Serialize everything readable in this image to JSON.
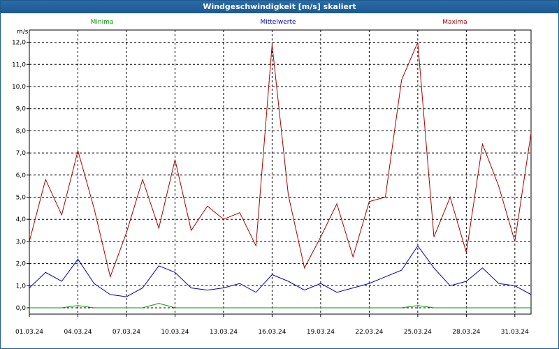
{
  "window": {
    "title": "Windgeschwindigkeit [m/s] skaliert"
  },
  "colors": {
    "minima": "#009900",
    "mean": "#0000bb",
    "maxima": "#aa0000"
  },
  "chart_data": {
    "type": "line",
    "title": "Windgeschwindigkeit [m/s] skaliert",
    "ylabel": "m/s",
    "ylim": [
      0,
      12.5
    ],
    "yticks": [
      "0,0",
      "1,0",
      "2,0",
      "3,0",
      "4,0",
      "5,0",
      "6,0",
      "7,0",
      "8,0",
      "9,0",
      "10,0",
      "11,0",
      "12,0"
    ],
    "xlim": [
      "01.03.24",
      "01.04.24"
    ],
    "xticks": [
      "01.03.24",
      "04.03.24",
      "07.03.24",
      "10.03.24",
      "13.03.24",
      "16.03.24",
      "19.03.24",
      "22.03.24",
      "25.03.24",
      "28.03.24",
      "31.03.24"
    ],
    "grid": true,
    "x": [
      "01.03.24",
      "02.03.24",
      "03.03.24",
      "04.03.24",
      "05.03.24",
      "06.03.24",
      "07.03.24",
      "08.03.24",
      "09.03.24",
      "10.03.24",
      "11.03.24",
      "12.03.24",
      "13.03.24",
      "14.03.24",
      "15.03.24",
      "16.03.24",
      "17.03.24",
      "18.03.24",
      "19.03.24",
      "20.03.24",
      "21.03.24",
      "22.03.24",
      "23.03.24",
      "24.03.24",
      "25.03.24",
      "26.03.24",
      "27.03.24",
      "28.03.24",
      "29.03.24",
      "30.03.24",
      "31.03.24",
      "01.04.24"
    ],
    "series": [
      {
        "name": "Minima",
        "values": [
          0,
          0,
          0,
          0.1,
          0,
          0,
          0,
          0,
          0.2,
          0,
          0,
          0,
          0,
          0,
          0,
          0,
          0,
          0,
          0,
          0,
          0,
          0,
          0,
          0,
          0.1,
          0,
          0,
          0,
          0,
          0,
          0,
          0
        ]
      },
      {
        "name": "Mittelwerte",
        "values": [
          0.9,
          1.6,
          1.2,
          2.2,
          1.1,
          0.6,
          0.5,
          0.9,
          1.9,
          1.6,
          0.9,
          0.8,
          0.9,
          1.1,
          0.7,
          1.5,
          1.2,
          0.8,
          1.1,
          0.7,
          0.9,
          1.1,
          1.4,
          1.7,
          2.8,
          1.8,
          1.0,
          1.2,
          1.8,
          1.1,
          1.0,
          0.6
        ]
      },
      {
        "name": "Maxima",
        "values": [
          3.0,
          5.8,
          4.2,
          7.1,
          4.5,
          1.4,
          3.4,
          5.8,
          3.6,
          6.7,
          3.5,
          4.6,
          4.0,
          4.3,
          2.8,
          11.9,
          5.1,
          1.8,
          3.2,
          4.7,
          2.3,
          4.8,
          5.0,
          10.3,
          12.0,
          3.2,
          5.0,
          2.5,
          7.4,
          5.5,
          3.0,
          7.9
        ]
      }
    ]
  }
}
